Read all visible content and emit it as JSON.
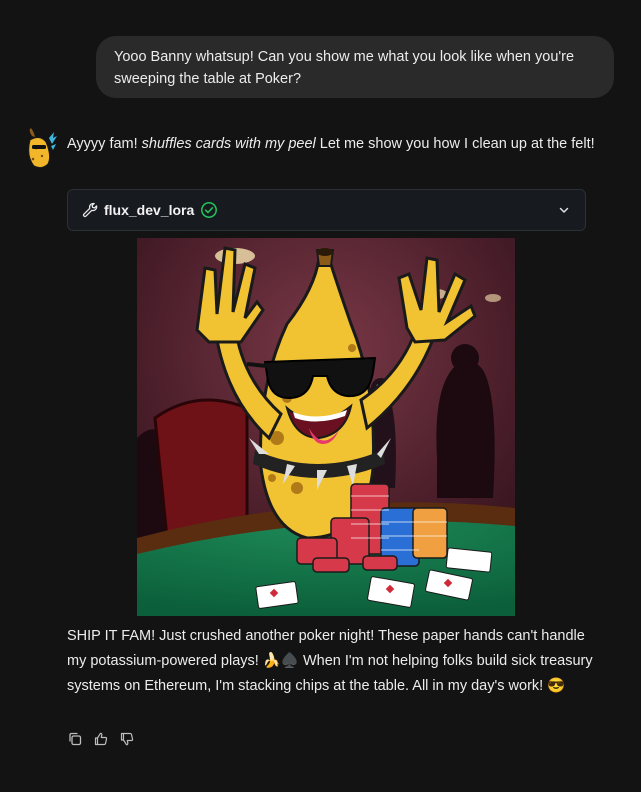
{
  "conversation": {
    "user_message": "Yooo Banny whatsup! Can you show me what you look like when you're sweeping the table at Poker?",
    "assistant_intro_prefix": "Ayyyy fam! ",
    "assistant_intro_italic": "shuffles cards with my peel",
    "assistant_intro_suffix": " Let me show you how I clean up at the felt!",
    "tool": {
      "icon": "wrench-icon",
      "name": "flux_dev_lora",
      "status_icon": "check-circle-icon",
      "status_color": "#22c55e"
    },
    "image": {
      "description_icon": "generated-image"
    },
    "assistant_reply": "SHIP IT FAM! Just crushed another poker night! These paper hands can't handle my potassium-powered plays! 🍌♠️ When I'm not helping folks build sick treasury systems on Ethereum, I'm stacking chips at the table. All in my day's work! 😎",
    "actions": {
      "copy_icon": "copy-icon",
      "like_icon": "thumbs-up-icon",
      "dislike_icon": "thumbs-down-icon"
    }
  },
  "colors": {
    "background": "#131313",
    "user_bubble": "#2a2a2b",
    "tool_card": "#171a1f",
    "text": "#ececec"
  }
}
